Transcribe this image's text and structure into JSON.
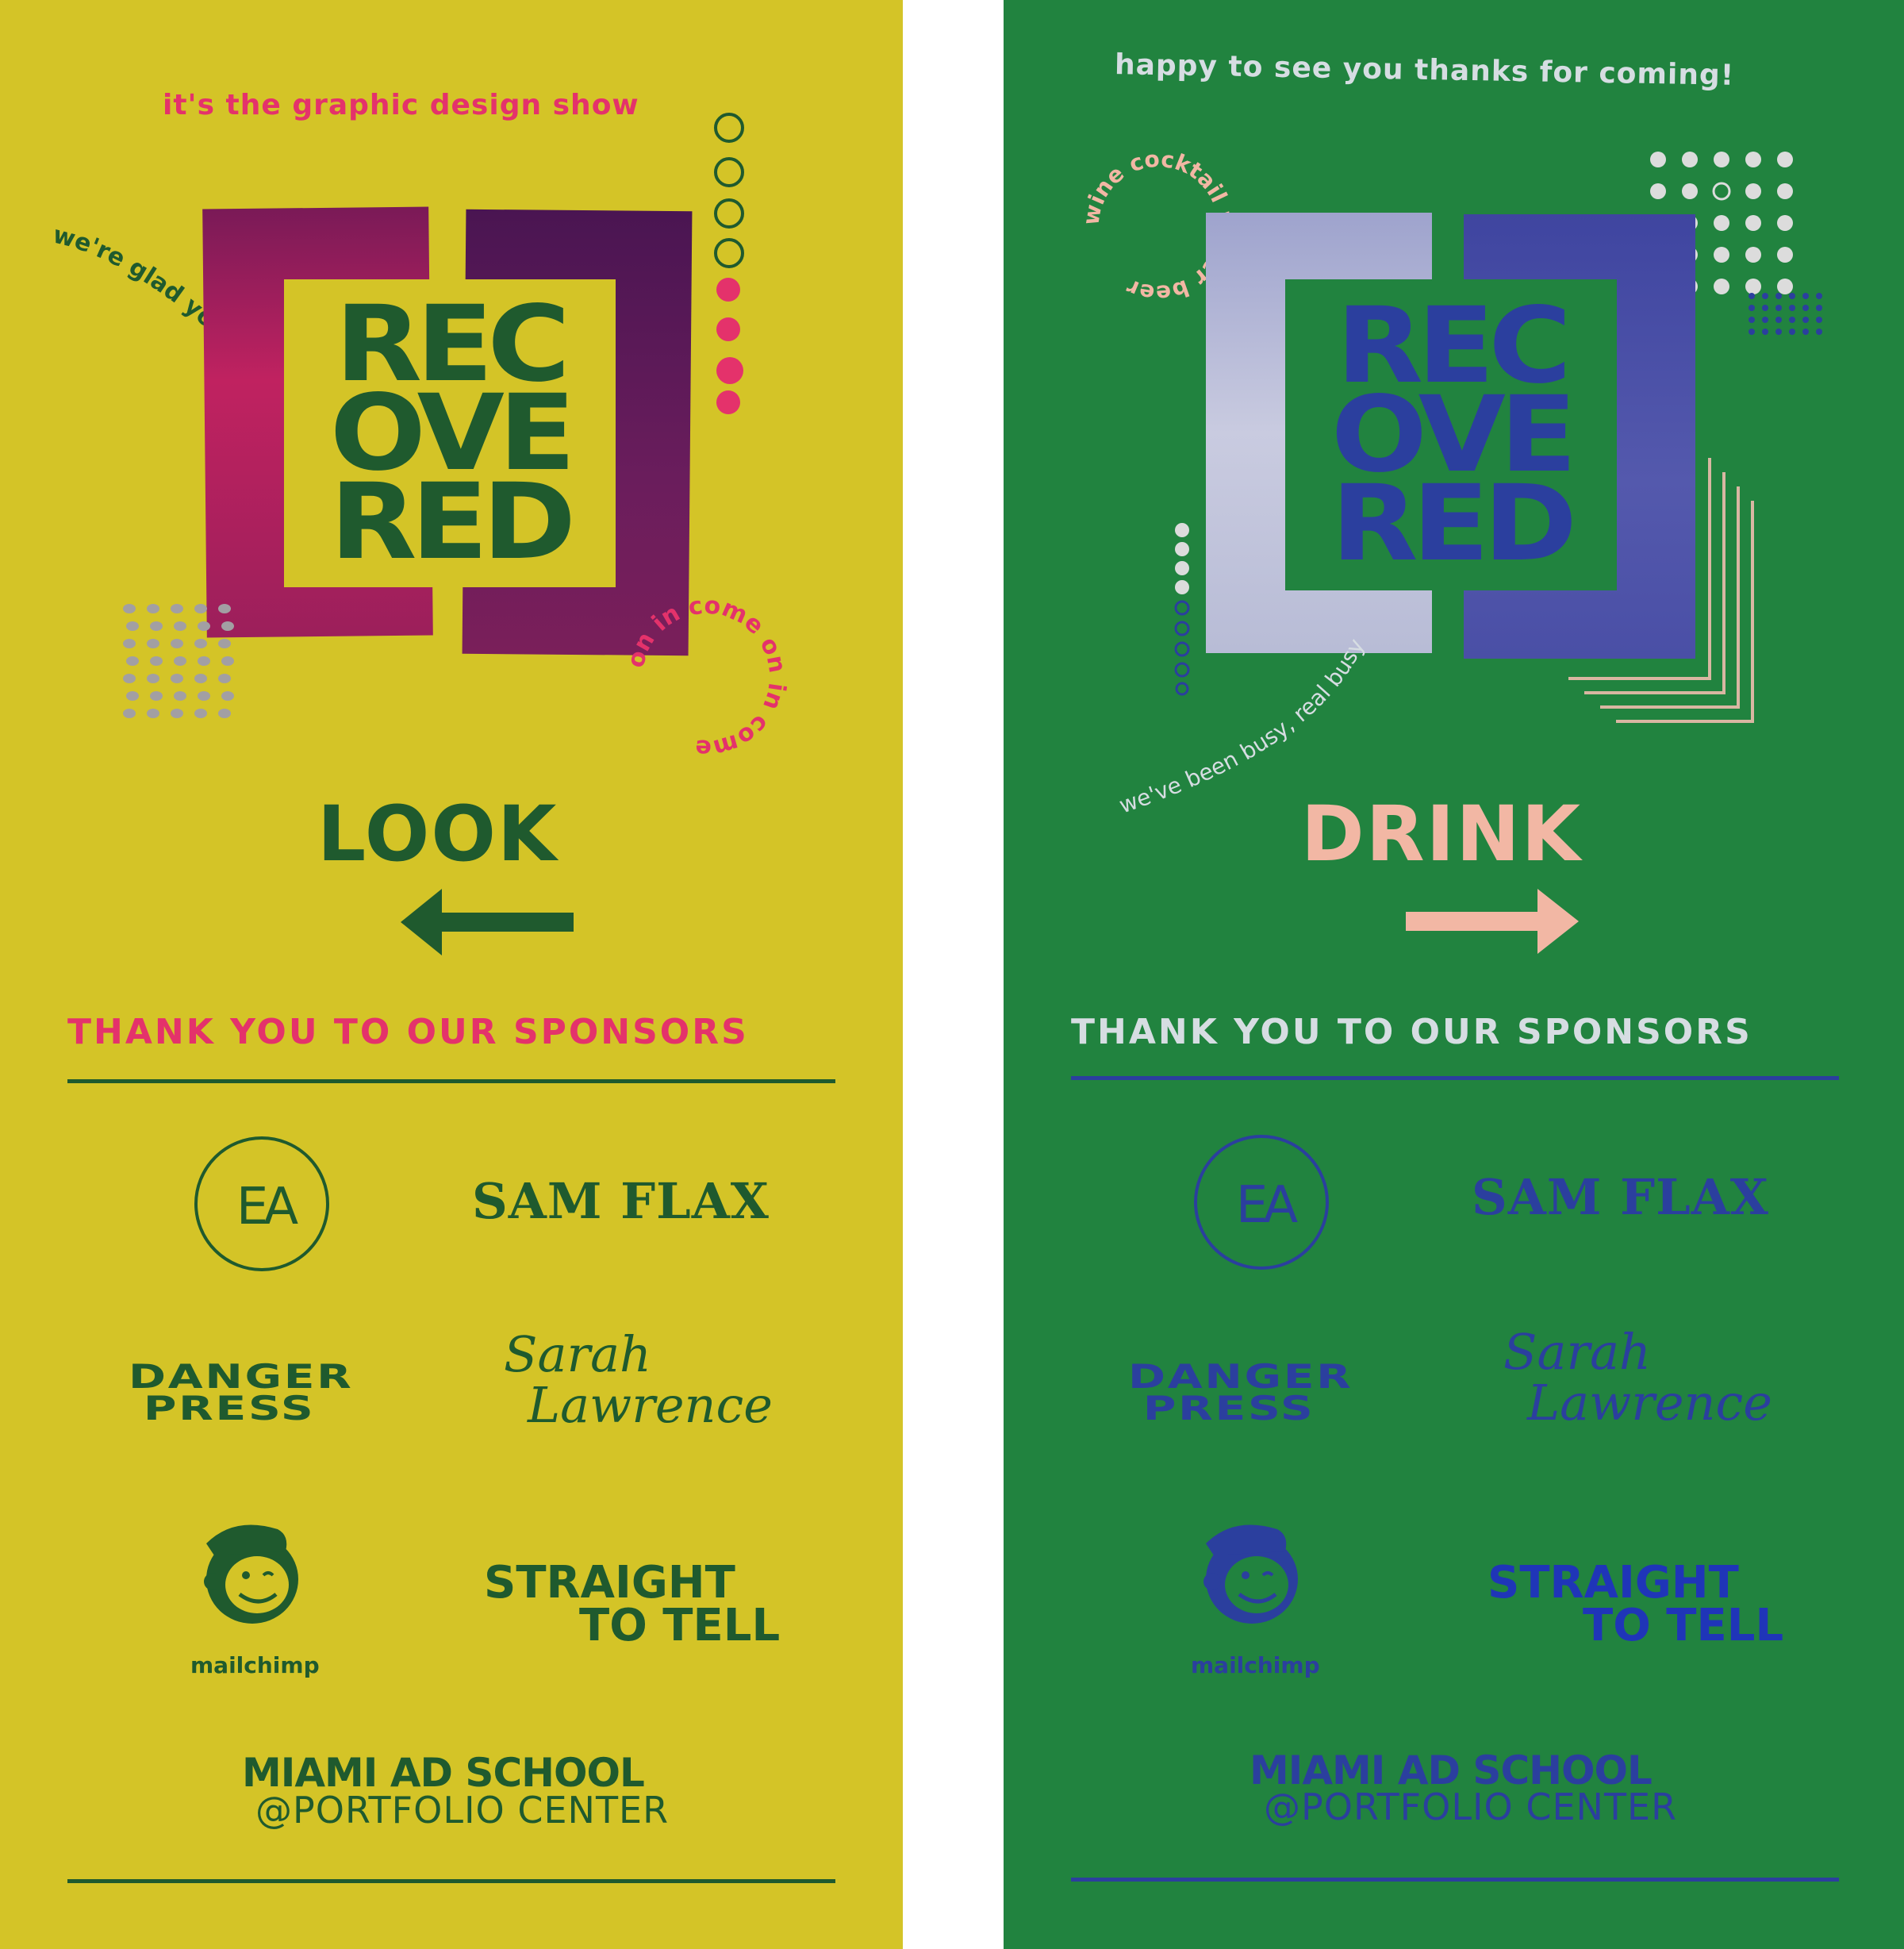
{
  "posters": [
    {
      "tagline_top": "it's the graphic design show",
      "curved_text_1": "we're glad you're here",
      "curved_text_2": "on in come on in come",
      "logo_lines": [
        "REC",
        "OVE",
        "RED"
      ],
      "direction_word": "LOOK",
      "arrow": "left",
      "sponsors_heading": "THANK YOU TO OUR SPONSORS",
      "sponsors": {
        "ea_monogram": "EA",
        "sam_flax": "SAM FLAX",
        "danger_press": [
          "DANGER",
          "PRESS"
        ],
        "sarah_lawrence": [
          "Sarah",
          "Lawrence"
        ],
        "mailchimp": "mailchimp",
        "straight_to_tell": [
          "STRAIGHT",
          "TO TELL"
        ],
        "miami_ad_school": "MIAMI AD SCHOOL",
        "portfolio_center": "@PORTFOLIO CENTER"
      },
      "colors": {
        "background": "#d4c427",
        "primary": "#1f5a2e",
        "accent": "#e4326b",
        "bracket_left": "#c02260",
        "bracket_right": "#5c1a55",
        "dots_grey": "#a29fa3"
      }
    },
    {
      "tagline_top": "happy to see you thanks for coming!",
      "curved_text_1": "wine cocktail water beer",
      "curved_text_2": "we've been busy, real busy",
      "logo_lines": [
        "REC",
        "OVE",
        "RED"
      ],
      "direction_word": "DRINK",
      "arrow": "right",
      "sponsors_heading": "THANK YOU TO OUR SPONSORS",
      "sponsors": {
        "ea_monogram": "EA",
        "sam_flax": "SAM FLAX",
        "danger_press": [
          "DANGER",
          "PRESS"
        ],
        "sarah_lawrence": [
          "Sarah",
          "Lawrence"
        ],
        "mailchimp": "mailchimp",
        "straight_to_tell": [
          "STRAIGHT",
          "TO TELL"
        ],
        "miami_ad_school": "MIAMI AD SCHOOL",
        "portfolio_center": "@PORTFOLIO CENTER"
      },
      "colors": {
        "background": "#21833f",
        "primary": "#2b3f9e",
        "accent": "#f2b7a4",
        "heading": "#d6dde2",
        "bracket_left": "#b4b8d6",
        "bracket_right": "#4c4fa5",
        "dots_light": "#dcdcdc"
      }
    }
  ]
}
